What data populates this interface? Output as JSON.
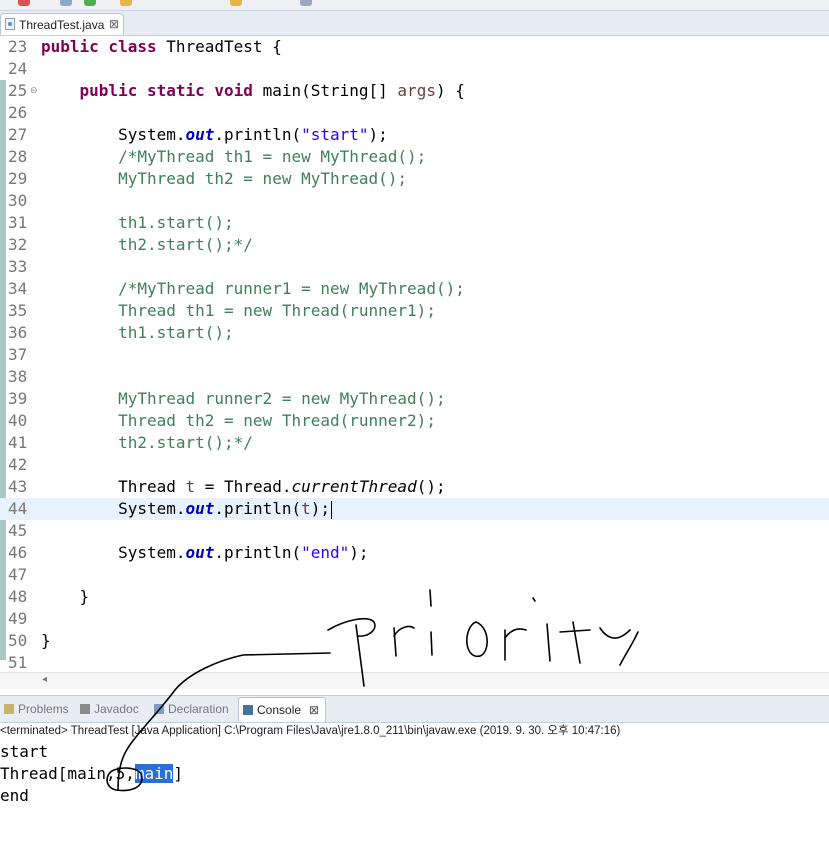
{
  "editor": {
    "tab_label": "ThreadTest.java",
    "tab_close": "⊠",
    "lines": [
      {
        "n": "23",
        "segs": [
          {
            "t": "kw",
            "v": "public class "
          },
          {
            "t": "",
            "v": "ThreadTest {"
          }
        ]
      },
      {
        "n": "24",
        "segs": []
      },
      {
        "n": "25",
        "fold": "⊖",
        "segs": [
          {
            "t": "",
            "v": "    "
          },
          {
            "t": "kw",
            "v": "public static void "
          },
          {
            "t": "",
            "v": "main(String[] "
          },
          {
            "t": "pv",
            "v": "args"
          },
          {
            "t": "",
            "v": ") {"
          }
        ]
      },
      {
        "n": "26",
        "segs": []
      },
      {
        "n": "27",
        "segs": [
          {
            "t": "",
            "v": "        System."
          },
          {
            "t": "fi",
            "v": "out"
          },
          {
            "t": "",
            "v": ".println("
          },
          {
            "t": "st",
            "v": "\"start\""
          },
          {
            "t": "",
            "v": ");"
          }
        ]
      },
      {
        "n": "28",
        "segs": [
          {
            "t": "cm",
            "v": "        /*MyThread th1 = new MyThread();"
          }
        ]
      },
      {
        "n": "29",
        "segs": [
          {
            "t": "cm",
            "v": "        MyThread th2 = new MyThread();"
          }
        ]
      },
      {
        "n": "30",
        "segs": []
      },
      {
        "n": "31",
        "segs": [
          {
            "t": "cm",
            "v": "        th1.start();"
          }
        ]
      },
      {
        "n": "32",
        "segs": [
          {
            "t": "cm",
            "v": "        th2.start();*/"
          }
        ]
      },
      {
        "n": "33",
        "segs": []
      },
      {
        "n": "34",
        "segs": [
          {
            "t": "cm",
            "v": "        /*MyThread runner1 = new MyThread();"
          }
        ]
      },
      {
        "n": "35",
        "segs": [
          {
            "t": "cm",
            "v": "        Thread th1 = new Thread(runner1);"
          }
        ]
      },
      {
        "n": "36",
        "segs": [
          {
            "t": "cm",
            "v": "        th1.start();"
          }
        ]
      },
      {
        "n": "37",
        "segs": []
      },
      {
        "n": "38",
        "segs": []
      },
      {
        "n": "39",
        "segs": [
          {
            "t": "cm",
            "v": "        MyThread runner2 = new MyThread();"
          }
        ]
      },
      {
        "n": "40",
        "segs": [
          {
            "t": "cm",
            "v": "        Thread th2 = new Thread(runner2);"
          }
        ]
      },
      {
        "n": "41",
        "segs": [
          {
            "t": "cm",
            "v": "        th2.start();*/"
          }
        ]
      },
      {
        "n": "42",
        "segs": []
      },
      {
        "n": "43",
        "segs": [
          {
            "t": "",
            "v": "        Thread "
          },
          {
            "t": "pv",
            "v": "t"
          },
          {
            "t": "",
            "v": " = Thread."
          },
          {
            "t": "mi",
            "v": "currentThread"
          },
          {
            "t": "",
            "v": "();"
          }
        ]
      },
      {
        "n": "44",
        "current": true,
        "cursor": true,
        "segs": [
          {
            "t": "",
            "v": "        System."
          },
          {
            "t": "fi",
            "v": "out"
          },
          {
            "t": "",
            "v": ".println("
          },
          {
            "t": "pv",
            "v": "t"
          },
          {
            "t": "",
            "v": ");"
          }
        ]
      },
      {
        "n": "45",
        "segs": []
      },
      {
        "n": "46",
        "segs": [
          {
            "t": "",
            "v": "        System."
          },
          {
            "t": "fi",
            "v": "out"
          },
          {
            "t": "",
            "v": ".println("
          },
          {
            "t": "st",
            "v": "\"end\""
          },
          {
            "t": "",
            "v": ");"
          }
        ]
      },
      {
        "n": "47",
        "segs": []
      },
      {
        "n": "48",
        "segs": [
          {
            "t": "",
            "v": "    }"
          }
        ]
      },
      {
        "n": "49",
        "segs": []
      },
      {
        "n": "50",
        "segs": [
          {
            "t": "",
            "v": "}"
          }
        ]
      },
      {
        "n": "51",
        "segs": []
      }
    ]
  },
  "views": {
    "tabs": [
      {
        "label": "Problems",
        "icon": "problems-icon",
        "active": false
      },
      {
        "label": "Javadoc",
        "icon": "at-icon",
        "active": false
      },
      {
        "label": "Declaration",
        "icon": "declaration-icon",
        "active": false
      },
      {
        "label": "Console",
        "icon": "console-icon",
        "active": true,
        "close": "⊠"
      }
    ]
  },
  "console": {
    "status": "<terminated> ThreadTest [Java Application] C:\\Program Files\\Java\\jre1.8.0_211\\bin\\javaw.exe (2019. 9. 30. 오후 10:47:16)",
    "line1": "start",
    "line2_prefix": "Thread[main,5,",
    "line2_selected": "main",
    "line2_suffix": "]",
    "line3": "end"
  },
  "colors": {
    "keyword": "#7f0055",
    "string": "#2a00ff",
    "comment": "#3f7f5f",
    "field": "#0000c0",
    "selection": "#2a6fd6",
    "current_line": "#e8f2fe"
  }
}
